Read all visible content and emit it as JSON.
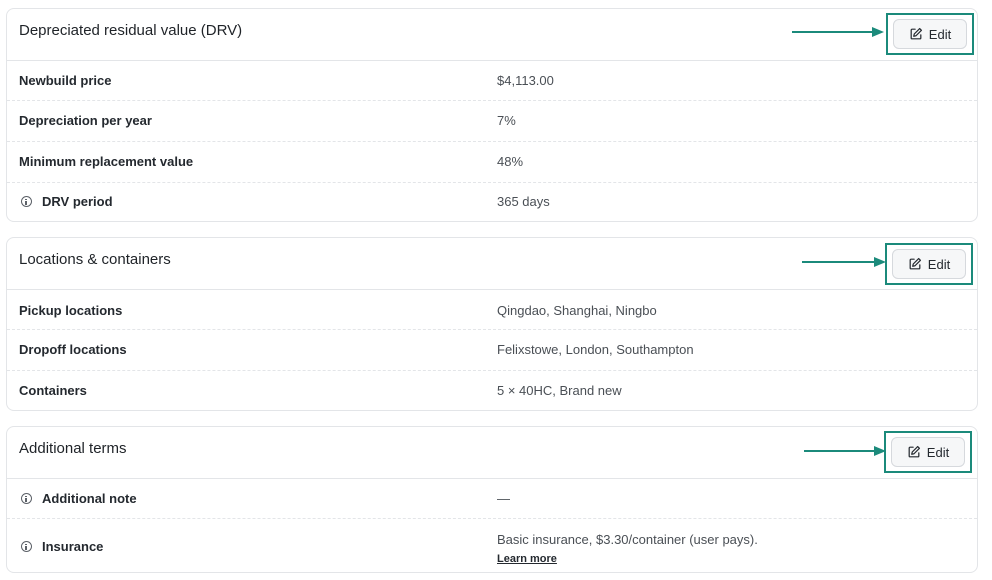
{
  "accent_color": "#1b8a7b",
  "sections": {
    "drv": {
      "title": "Depreciated residual value (DRV)",
      "edit_label": "Edit",
      "rows": [
        {
          "label": "Newbuild price",
          "value": "$4,113.00"
        },
        {
          "label": "Depreciation per year",
          "value": "7%"
        },
        {
          "label": "Minimum replacement value",
          "value": "48%"
        },
        {
          "label": "DRV period",
          "value": "365 days",
          "icon": "info-icon"
        }
      ]
    },
    "locations": {
      "title": "Locations & containers",
      "edit_label": "Edit",
      "rows": [
        {
          "label": "Pickup locations",
          "value": "Qingdao, Shanghai, Ningbo"
        },
        {
          "label": "Dropoff locations",
          "value": "Felixstowe, London, Southampton"
        },
        {
          "label": "Containers",
          "value": "5 × 40HC, Brand new"
        }
      ]
    },
    "terms": {
      "title": "Additional terms",
      "edit_label": "Edit",
      "rows": [
        {
          "label": "Additional note",
          "value": "—",
          "icon": "info-icon"
        },
        {
          "label": "Insurance",
          "value": "Basic insurance, $3.30/container (user pays).",
          "link": "Learn more",
          "icon": "info-icon"
        }
      ]
    }
  }
}
